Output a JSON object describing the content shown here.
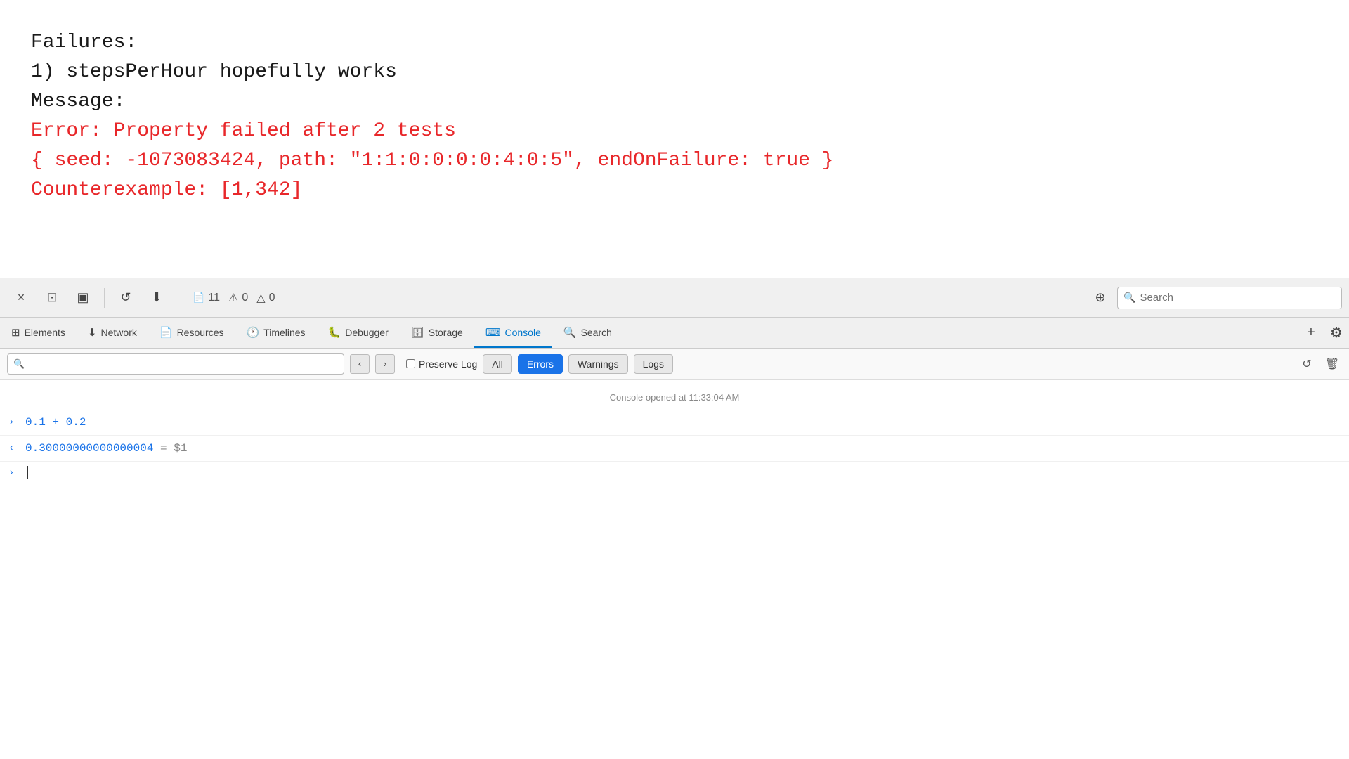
{
  "browser": {
    "content": {
      "line1": "Failures:",
      "line2": "1) stepsPerHour hopefully works",
      "line3": "   Message:",
      "error1": "      Error: Property failed after 2 tests",
      "error2": "      { seed: -1073083424, path: \"1:1:0:0:0:0:4:0:5\", endOnFailure: true }",
      "error3": "      Counterexample: [1,342]"
    }
  },
  "devtools": {
    "toolbar": {
      "close_label": "×",
      "undock_label": "⊡",
      "dock_label": "▣",
      "reload_label": "↺",
      "download_label": "⬇",
      "pages_count": "11",
      "errors_count": "0",
      "warnings_count": "0",
      "target_label": "⊕",
      "search_placeholder": "Search"
    },
    "tabs": [
      {
        "label": "Elements",
        "icon": "⊞",
        "active": false
      },
      {
        "label": "Network",
        "icon": "⬇",
        "active": false
      },
      {
        "label": "Resources",
        "icon": "📄",
        "active": false
      },
      {
        "label": "Timelines",
        "icon": "🕐",
        "active": false
      },
      {
        "label": "Debugger",
        "icon": "🐛",
        "active": false
      },
      {
        "label": "Storage",
        "icon": "🗄",
        "active": false
      },
      {
        "label": "Console",
        "icon": "⌨",
        "active": true
      },
      {
        "label": "Search",
        "icon": "🔍",
        "active": false
      }
    ],
    "console": {
      "filter_placeholder": "",
      "preserve_log_label": "Preserve Log",
      "all_label": "All",
      "errors_label": "Errors",
      "warnings_label": "Warnings",
      "logs_label": "Logs",
      "timestamp": "Console opened at 11:33:04 AM",
      "entries": [
        {
          "type": "input",
          "arrow": ">",
          "text": "0.1 + 0.2"
        },
        {
          "type": "output",
          "arrow": "<",
          "text": "0.30000000000000004",
          "special": " = $1"
        }
      ],
      "prompt_arrow": ">"
    }
  }
}
